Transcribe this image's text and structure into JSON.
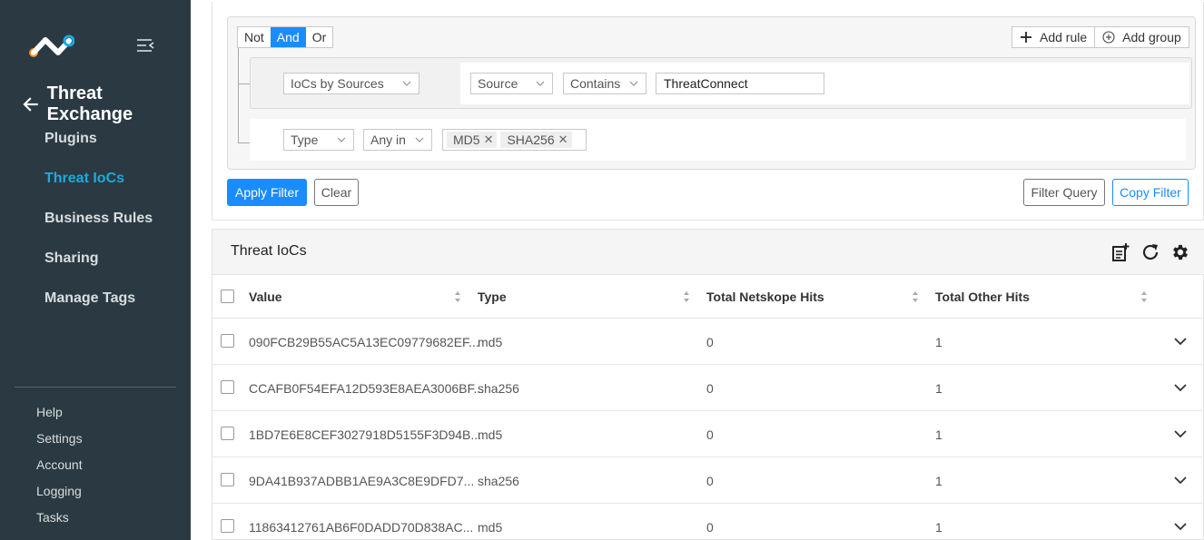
{
  "sidebar": {
    "module_title": "Threat Exchange",
    "items": [
      {
        "label": "Plugins"
      },
      {
        "label": "Threat IoCs"
      },
      {
        "label": "Business Rules"
      },
      {
        "label": "Sharing"
      },
      {
        "label": "Manage Tags"
      }
    ],
    "active_item": "Threat IoCs",
    "bottom_items": [
      {
        "label": "Help"
      },
      {
        "label": "Settings"
      },
      {
        "label": "Account"
      },
      {
        "label": "Logging"
      },
      {
        "label": "Tasks"
      }
    ]
  },
  "filter": {
    "combinators": [
      "Not",
      "And",
      "Or"
    ],
    "active_combinator": "And",
    "add_rule_label": "Add rule",
    "add_group_label": "Add group",
    "group_field": "IoCs by Sources",
    "rule1": {
      "field": "Source",
      "operator": "Contains",
      "value": "ThreatConnect"
    },
    "rule2": {
      "field": "Type",
      "operator": "Any in",
      "values": [
        "MD5",
        "SHA256"
      ]
    },
    "apply_label": "Apply Filter",
    "clear_label": "Clear",
    "query_label": "Filter Query",
    "copy_label": "Copy Filter"
  },
  "table": {
    "title": "Threat IoCs",
    "columns": [
      "Value",
      "Type",
      "Total Netskope Hits",
      "Total Other Hits"
    ],
    "rows": [
      {
        "value": "090FCB29B55AC5A13EC09779682EF...",
        "type": "md5",
        "netskope_hits": "0",
        "other_hits": "1"
      },
      {
        "value": "CCAFB0F54EFA12D593E8AEA3006BF...",
        "type": "sha256",
        "netskope_hits": "0",
        "other_hits": "1"
      },
      {
        "value": "1BD7E6E8CEF3027918D5155F3D94B...",
        "type": "md5",
        "netskope_hits": "0",
        "other_hits": "1"
      },
      {
        "value": "9DA41B937ADBB1AE9A3C8E9DFD7...",
        "type": "sha256",
        "netskope_hits": "0",
        "other_hits": "1"
      },
      {
        "value": "11863412761AB6F0DADD70D838AC...",
        "type": "md5",
        "netskope_hits": "0",
        "other_hits": "1"
      }
    ]
  },
  "colors": {
    "sidebar_bg": "#2b3a42",
    "accent": "#1a8cff",
    "active_nav": "#1fa8e0"
  },
  "icons": [
    "netskope-logo",
    "collapse-menu-icon",
    "back-arrow-icon",
    "plus-icon",
    "plus-circle-icon",
    "chevron-down-icon",
    "close-icon",
    "export-icon",
    "refresh-icon",
    "gear-icon",
    "sort-icon"
  ]
}
